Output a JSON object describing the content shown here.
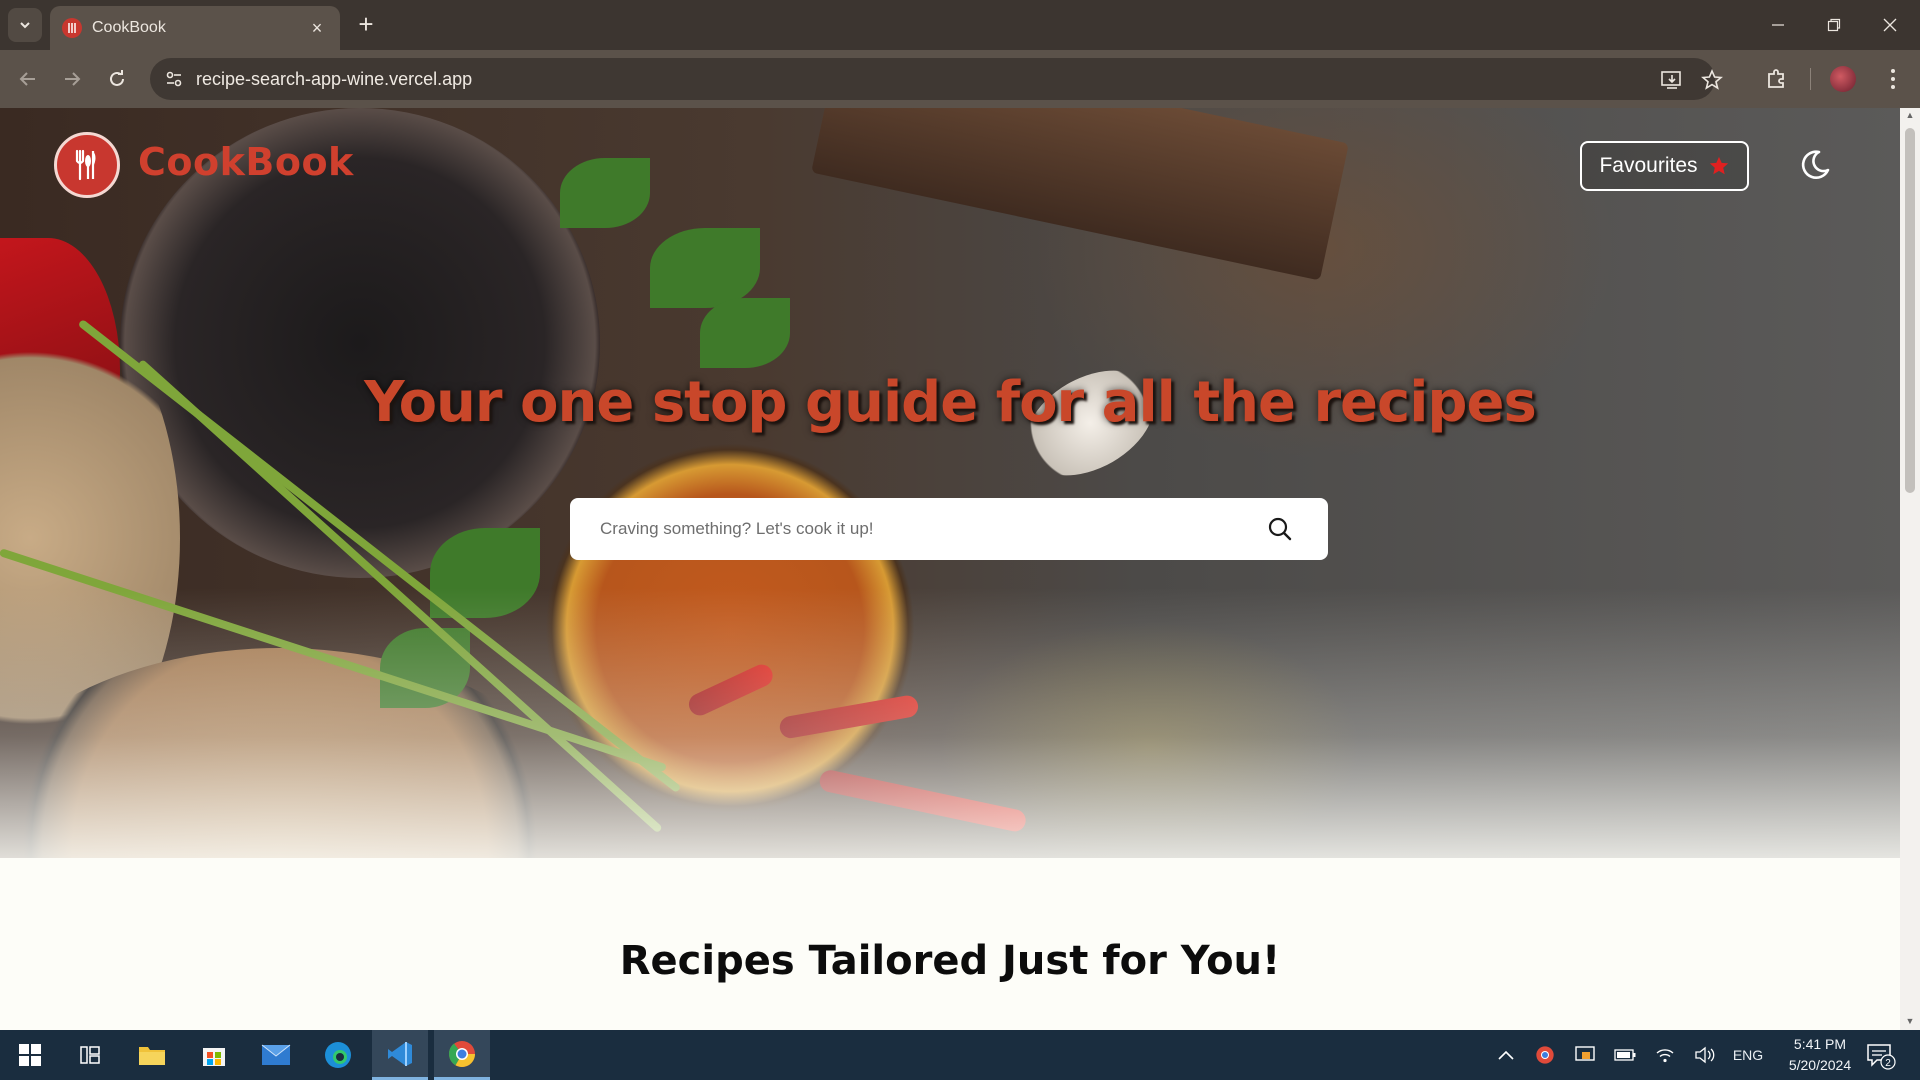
{
  "browser": {
    "tab_title": "CookBook",
    "url": "recipe-search-app-wine.vercel.app",
    "new_tab_symbol": "+",
    "close_tab_symbol": "×"
  },
  "site": {
    "brand": "CookBook",
    "favourites_label": "Favourites",
    "headline": "Your one stop guide for all the recipes",
    "search_placeholder": "Craving something? Let's cook it up!",
    "section_title": "Recipes Tailored Just for You!",
    "colors": {
      "accent": "#d0402e",
      "star": "#e02020",
      "search_bg": "#ffffff",
      "page_bg": "#fdfdf8"
    }
  },
  "taskbar": {
    "language": "ENG",
    "time": "5:41 PM",
    "date": "5/20/2024",
    "notification_count": "2"
  },
  "icons": [
    "tab-search-icon",
    "restaurant-favicon",
    "close-icon",
    "plus-icon",
    "minimize-icon",
    "restore-icon",
    "window-close-icon",
    "back-icon",
    "forward-icon",
    "reload-icon",
    "site-info-icon",
    "install-icon",
    "bookmark-star-icon",
    "extensions-icon",
    "menu-dots-icon",
    "logo-cutlery-icon",
    "star-icon",
    "moon-icon",
    "search-icon",
    "windows-start-icon",
    "task-view-icon",
    "file-explorer-icon",
    "store-icon",
    "mail-icon",
    "edge-icon",
    "vscode-icon",
    "chrome-icon",
    "chevron-up-icon",
    "wifi-icon",
    "volume-icon",
    "battery-icon",
    "notification-icon"
  ]
}
